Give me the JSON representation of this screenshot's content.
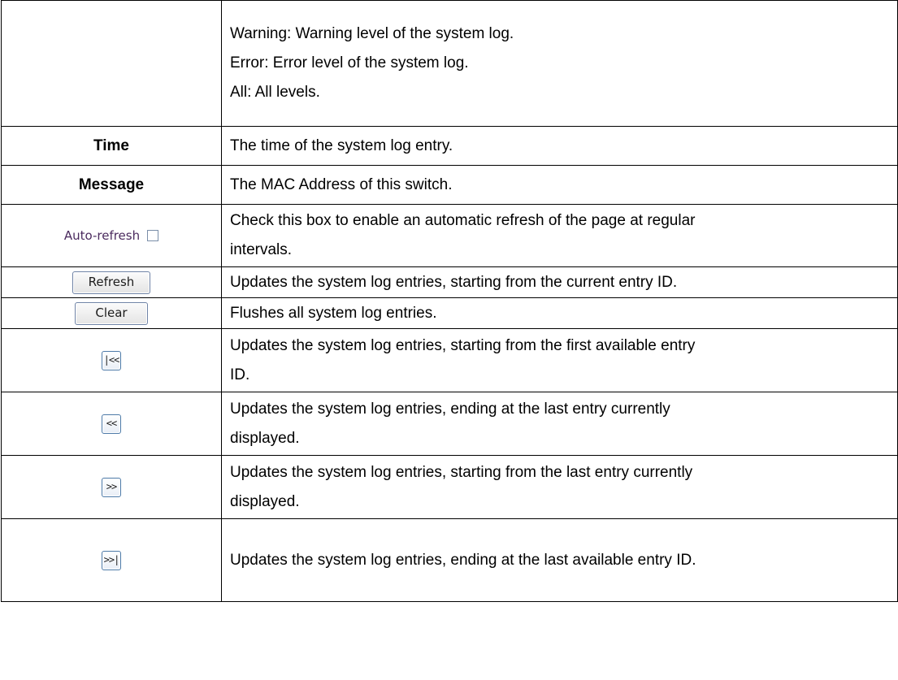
{
  "rows": {
    "level": {
      "lines": [
        "Warning: Warning level of the system log.",
        "Error: Error level of the system log.",
        "All: All levels."
      ]
    },
    "time": {
      "term": "Time",
      "desc": "The time of the system log entry."
    },
    "message": {
      "term": "Message",
      "desc": "The MAC Address of this switch."
    },
    "auto_refresh": {
      "label": "Auto-refresh",
      "checked": false,
      "desc_lines": [
        "Check this box to enable an automatic refresh of the page at regular",
        "intervals."
      ]
    },
    "refresh": {
      "button": "Refresh",
      "desc": "Updates the system log entries, starting from the current entry ID."
    },
    "clear": {
      "button": "Clear",
      "desc": "Flushes all system log entries."
    },
    "first": {
      "button": "|<<",
      "desc_lines": [
        "Updates the system log entries, starting from the first available entry",
        "ID."
      ]
    },
    "prev": {
      "button": "<<",
      "desc_lines": [
        "Updates the system log entries, ending at the last entry currently",
        "displayed."
      ]
    },
    "next": {
      "button": ">>",
      "desc_lines": [
        "Updates the system log entries, starting from the last entry currently",
        "displayed."
      ]
    },
    "last": {
      "button": ">>|",
      "desc": "Updates the system log entries, ending at the last available entry ID."
    }
  }
}
